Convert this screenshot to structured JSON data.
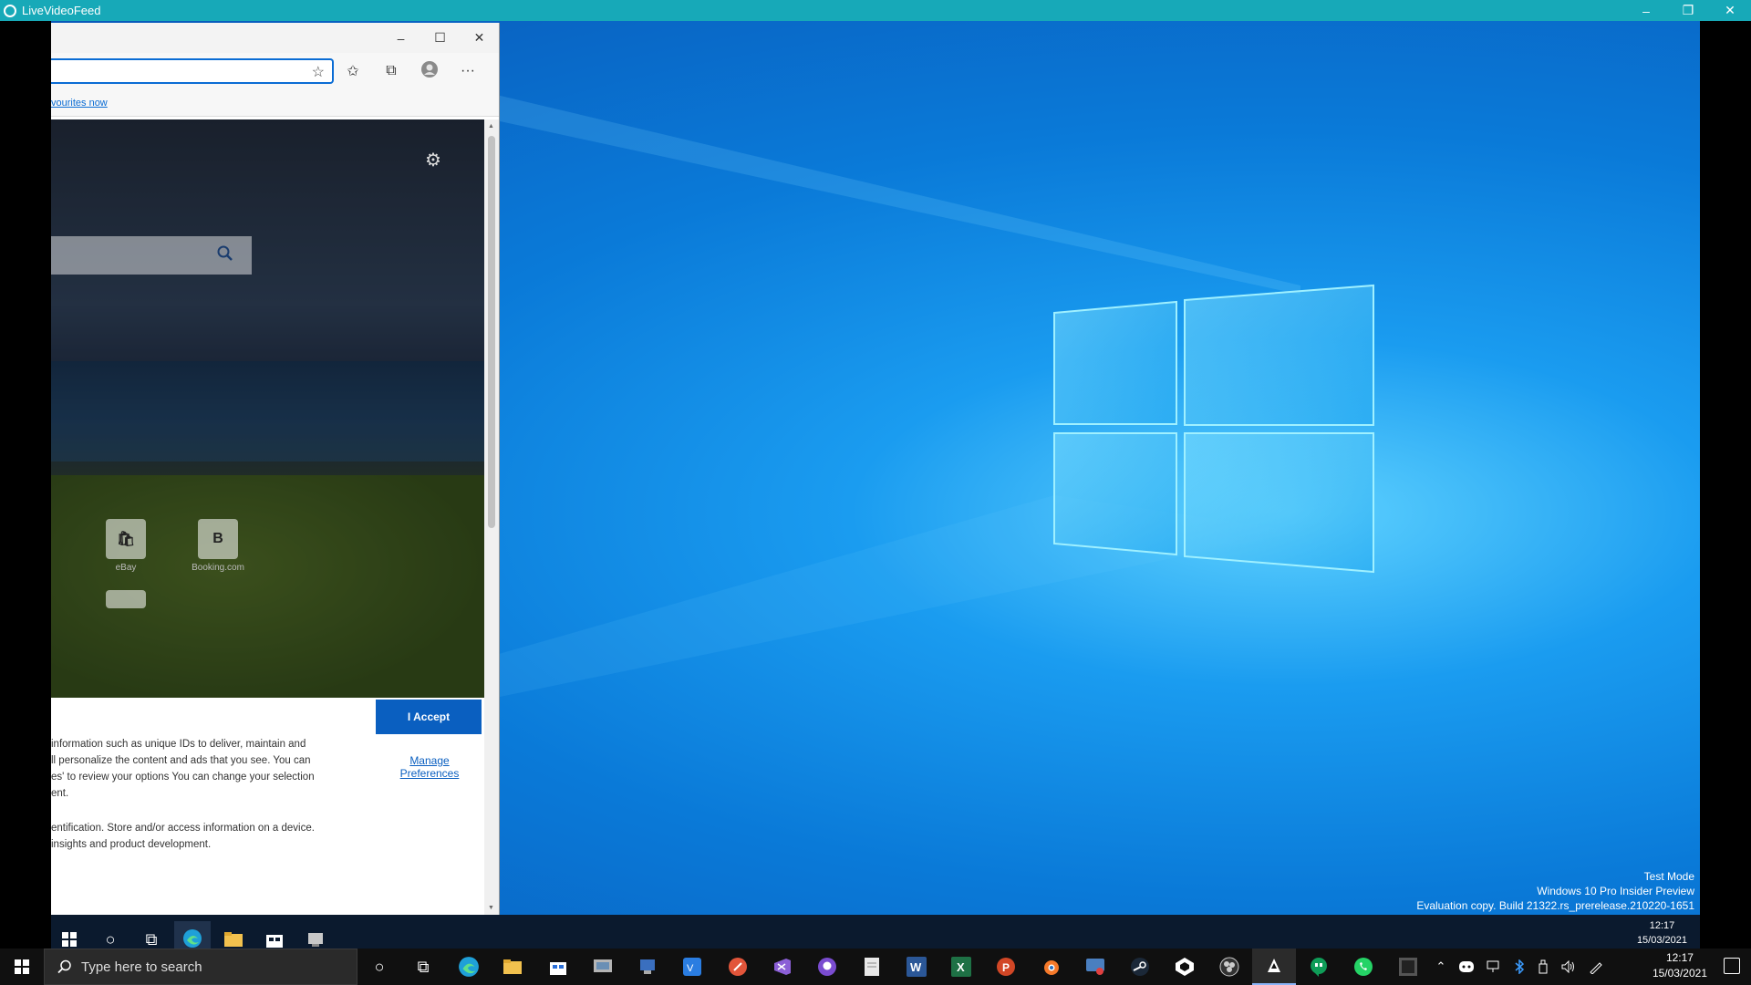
{
  "outer_window": {
    "title": "LiveVideoFeed",
    "minimize": "–",
    "restore": "❐",
    "close": "✕"
  },
  "edge": {
    "minimize": "–",
    "maximize": "☐",
    "close": "✕",
    "favourite_star": "☆",
    "favourites_icon": "✩",
    "collections_icon": "⧉",
    "more": "···",
    "favourites_bar_link": "vourites now",
    "settings_icon": "⚙",
    "tiles": [
      {
        "glyph": "🛍",
        "label": "eBay"
      },
      {
        "glyph": "B",
        "label": "Booking.com"
      }
    ],
    "consent": {
      "accept": "I Accept",
      "manage_line1": "Manage",
      "manage_line2": "Preferences",
      "para1": [
        "information such as unique IDs to deliver, maintain and",
        "ll personalize the content and ads that you see. You can",
        "es' to review your options  You can change your selection",
        "ent."
      ],
      "para2": [
        "entification. Store and/or access information on a device.",
        "insights and product development."
      ]
    }
  },
  "remote_desktop": {
    "watermark": [
      "Test Mode",
      "Windows 10 Pro Insider Preview",
      "Evaluation copy. Build 21322.rs_prerelease.210220-1651"
    ],
    "time": "12:17",
    "date": "15/03/2021"
  },
  "taskbar": {
    "search_placeholder": "Type here to search",
    "time": "12:17",
    "date": "15/03/2021",
    "apps": [
      "cortana",
      "task-view",
      "edge",
      "file-explorer",
      "store",
      "windows-media",
      "app-installer",
      "vs-code",
      "git-client",
      "visual-studio",
      "github-desktop",
      "notepad",
      "word",
      "excel",
      "powerpoint",
      "blender",
      "app-remote",
      "steam",
      "unity",
      "obs",
      "live-video-feed",
      "hangouts",
      "whatsapp",
      "terminal"
    ]
  },
  "colors": {
    "outer_titlebar": "#17a9b8",
    "desktop_blue": "#0a7ad8",
    "accent": "#0a5fc0"
  }
}
